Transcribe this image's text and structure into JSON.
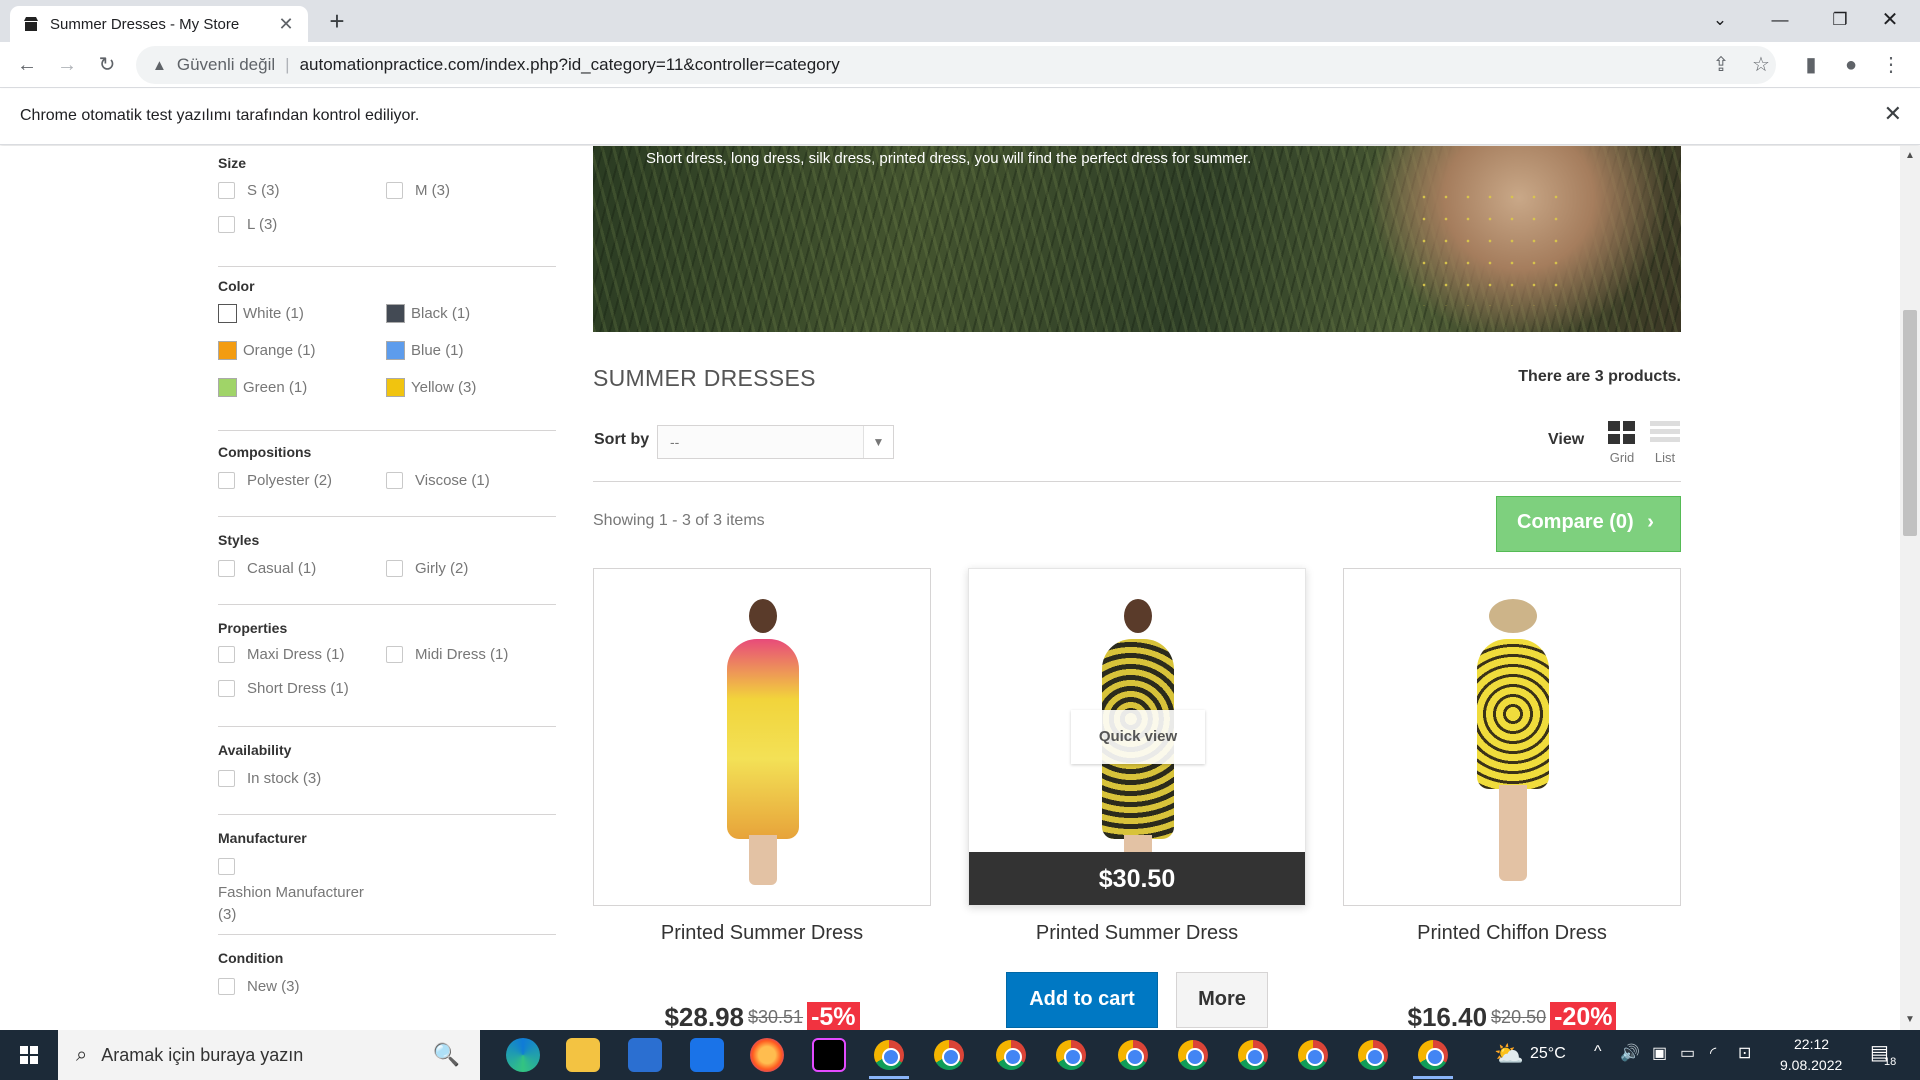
{
  "browser": {
    "tab_title": "Summer Dresses - My Store",
    "security_label": "Güvenli değil",
    "url": "automationpractice.com/index.php?id_category=11&controller=category",
    "infobar_text": "Chrome otomatik test yazılımı tarafından kontrol ediliyor."
  },
  "sidebar": {
    "size": {
      "title": "Size",
      "options": [
        "S (3)",
        "M (3)",
        "L (3)"
      ]
    },
    "color": {
      "title": "Color",
      "options": [
        {
          "label": "White (1)",
          "color": "#ffffff"
        },
        {
          "label": "Black (1)",
          "color": "#434a54"
        },
        {
          "label": "Orange (1)",
          "color": "#f39c11"
        },
        {
          "label": "Blue (1)",
          "color": "#5d9cec"
        },
        {
          "label": "Green (1)",
          "color": "#a0d468"
        },
        {
          "label": "Yellow (3)",
          "color": "#f1c40f"
        }
      ]
    },
    "compositions": {
      "title": "Compositions",
      "options": [
        "Polyester (2)",
        "Viscose (1)"
      ]
    },
    "styles": {
      "title": "Styles",
      "options": [
        "Casual (1)",
        "Girly (2)"
      ]
    },
    "properties": {
      "title": "Properties",
      "options": [
        "Maxi Dress (1)",
        "Midi Dress (1)",
        "Short Dress (1)"
      ]
    },
    "availability": {
      "title": "Availability",
      "options": [
        "In stock (3)"
      ]
    },
    "manufacturer": {
      "title": "Manufacturer",
      "options": [
        "Fashion Manufacturer",
        "(3)"
      ]
    },
    "condition": {
      "title": "Condition",
      "options": [
        "New (3)"
      ]
    }
  },
  "main": {
    "banner_caption": "Short dress, long dress, silk dress, printed dress, you will find the perfect dress for summer.",
    "category_title": "SUMMER DRESSES",
    "product_count": "There are 3 products.",
    "sort_label": "Sort by",
    "sort_value": "--",
    "view_label": "View",
    "view_grid": "Grid",
    "view_list": "List",
    "showing": "Showing 1 - 3 of 3 items",
    "compare": "Compare (0)"
  },
  "products": [
    {
      "name": "Printed Summer Dress",
      "price": "$28.98",
      "old_price": "$30.51",
      "discount": "-5%"
    },
    {
      "name": "Printed Summer Dress",
      "price_bar": "$30.50",
      "quick_view": "Quick view",
      "add_to_cart": "Add to cart",
      "more": "More"
    },
    {
      "name": "Printed Chiffon Dress",
      "price": "$16.40",
      "old_price": "$20.50",
      "discount": "-20%"
    }
  ],
  "taskbar": {
    "search_placeholder": "Aramak için buraya yazın",
    "weather": "25°C",
    "time": "22:12",
    "date": "9.08.2022",
    "notifications": "18"
  }
}
